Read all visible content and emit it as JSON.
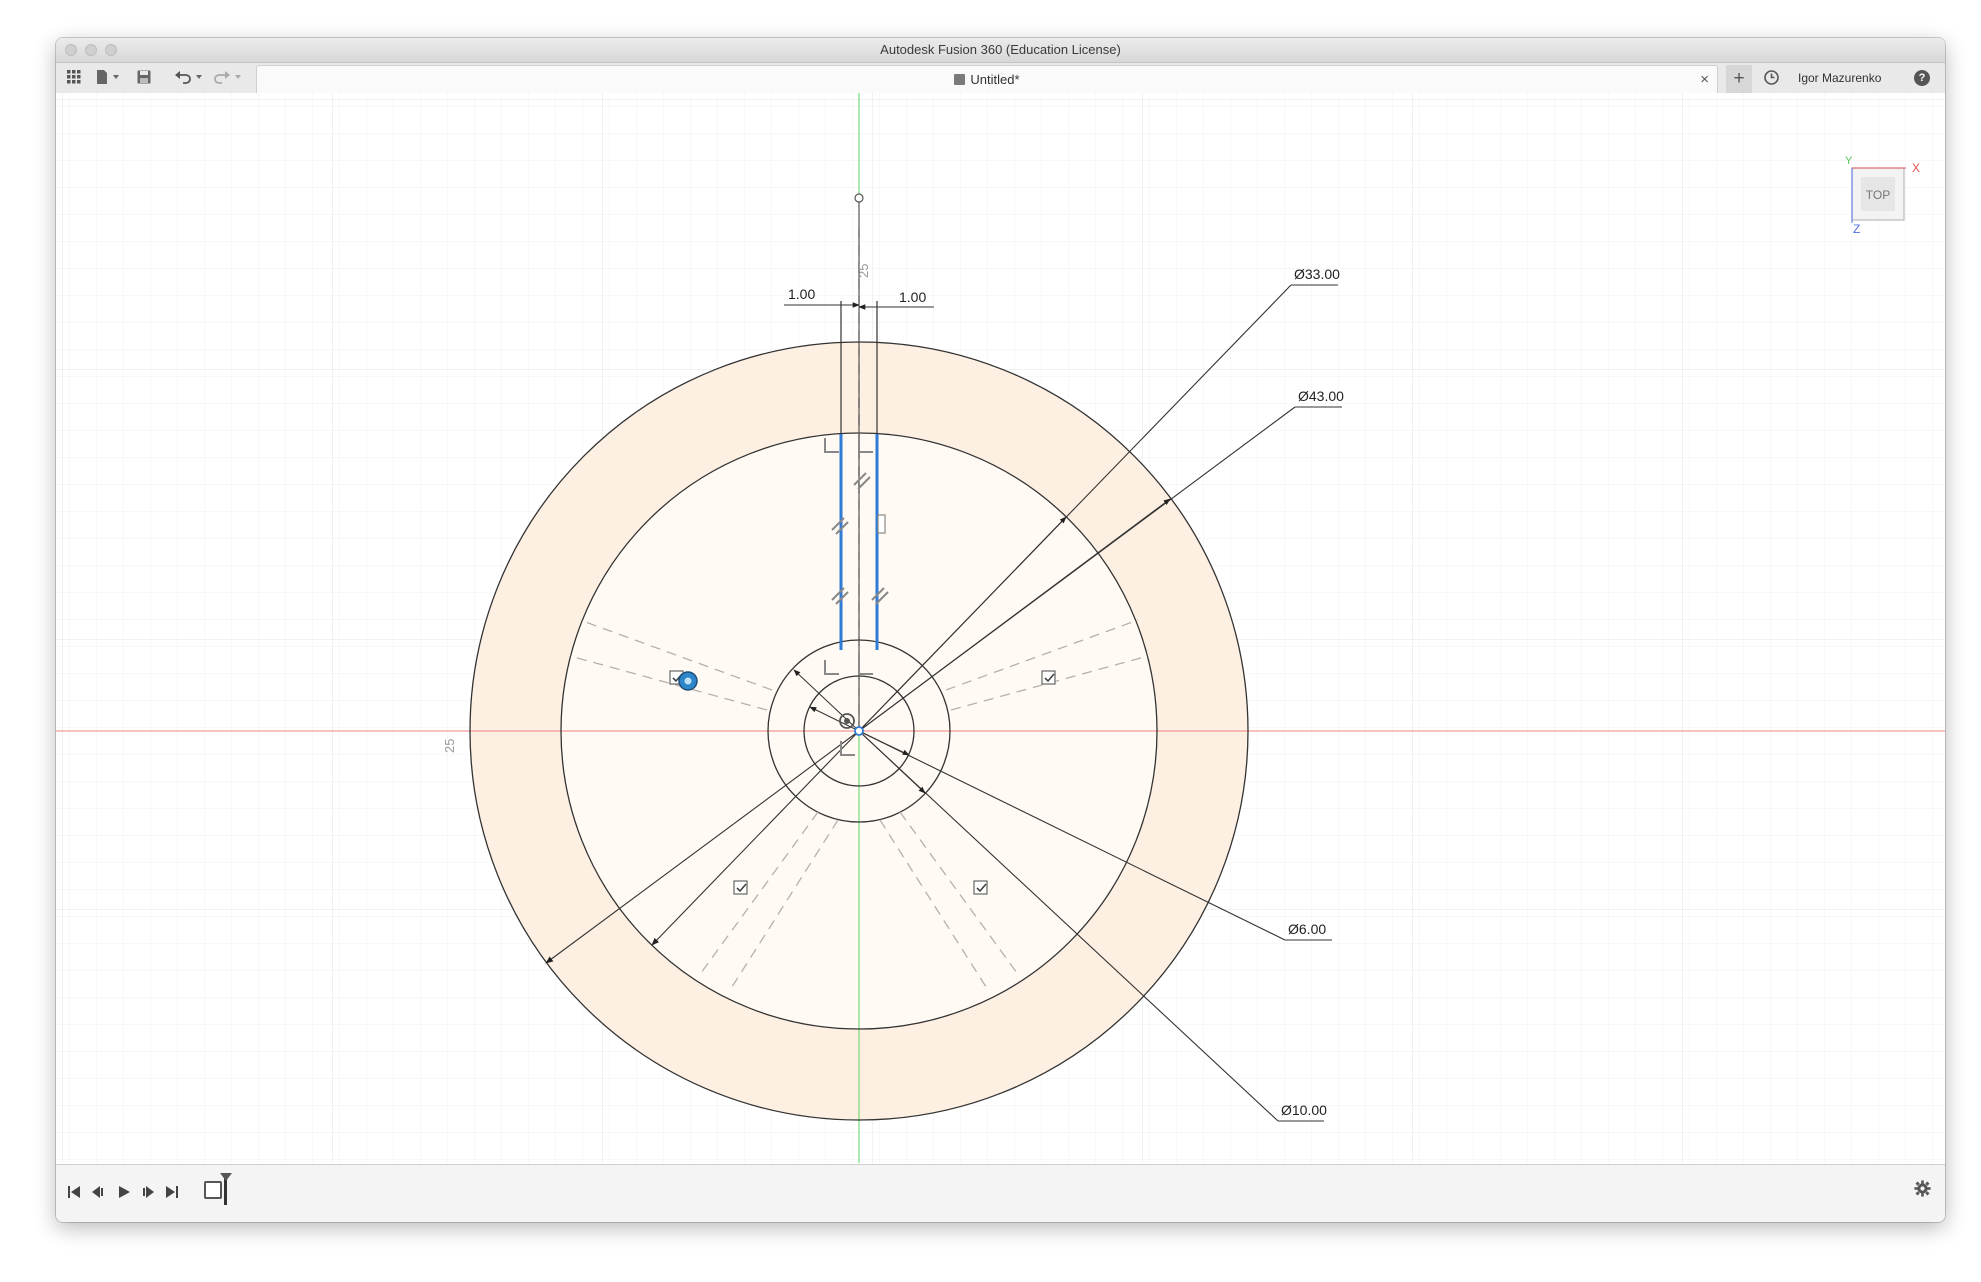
{
  "window": {
    "title": "Autodesk Fusion 360 (Education License)"
  },
  "toolbar": {
    "icons": [
      "data-panel-grid-icon",
      "file-icon",
      "save-icon",
      "undo-icon",
      "redo-icon"
    ],
    "document_tab": "Untitled*",
    "close_tab": "×",
    "new_tab": "+",
    "job_status_icon": "job-status-clock-icon",
    "user": "Igor Mazurenko",
    "help": "?"
  },
  "viewcube": {
    "face": "TOP",
    "x_label": "X",
    "y_label": "Y",
    "z_label": "Z",
    "colors": {
      "x": "#e25353",
      "y": "#55c255",
      "z": "#4f6fe3"
    }
  },
  "sketch": {
    "dimensions": {
      "d33": "Ø33.00",
      "d43": "Ø43.00",
      "d6": "Ø6.00",
      "d10": "Ø10.00",
      "slot_left": "1.00",
      "slot_right": "1.00"
    },
    "grid_labels": {
      "vertical_axis": "25",
      "horizontal_axis": "25"
    },
    "colors": {
      "profile_fill": "#fdf0e2",
      "axis_x": "#f08080",
      "axis_y": "#5fd35f",
      "selected_line": "#2f7bd6",
      "geometry": "#333333"
    }
  },
  "timeline": {
    "controls": [
      "skip-start-icon",
      "step-back-icon",
      "play-icon",
      "step-forward-icon",
      "skip-end-icon"
    ],
    "settings_icon": "gear-icon"
  }
}
